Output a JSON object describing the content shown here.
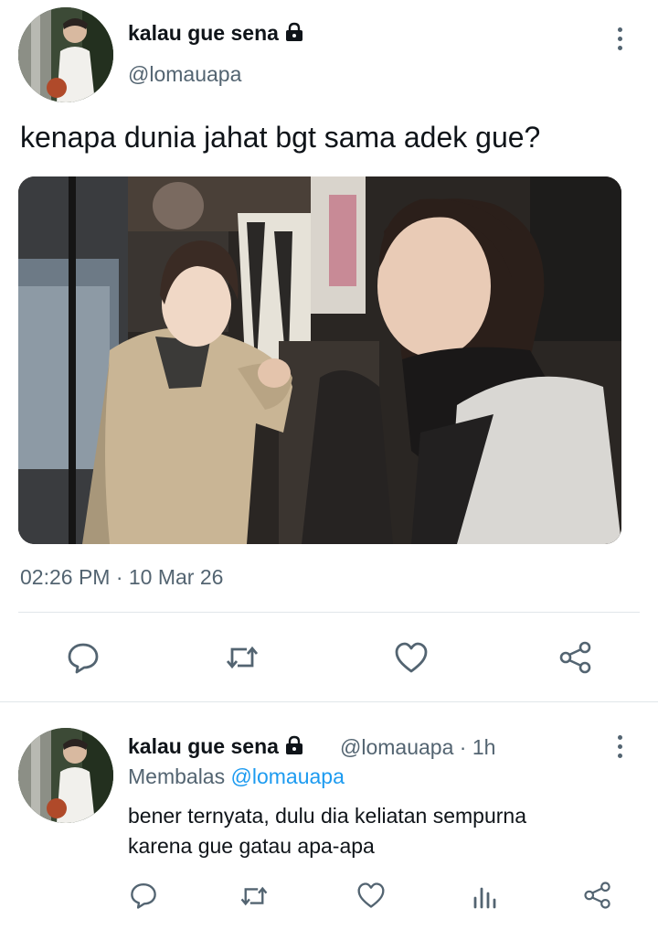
{
  "tweet": {
    "display_name": "kalau gue sena",
    "handle": "@lomauapa",
    "text": "kenapa dunia jahat bgt sama adek gue?",
    "timestamp": "02:26 PM · 10 Mar 26",
    "icons": [
      "lock-icon",
      "more-icon",
      "reply-icon",
      "retweet-icon",
      "like-icon",
      "share-icon"
    ]
  },
  "reply": {
    "display_name": "kalau gue sena",
    "handle": "@lomauapa",
    "separator": " · ",
    "age": "1h",
    "replying_label": "Membalas",
    "replying_to": "@lomauapa",
    "text_line1": "bener ternyata, dulu dia keliatan sempurna",
    "text_line2": "karena gue gatau apa-apa",
    "icons": [
      "reply-icon",
      "retweet-icon",
      "like-icon",
      "analytics-icon",
      "share-icon"
    ]
  },
  "colors": {
    "text_primary": "#0f1419",
    "text_secondary": "#536471",
    "link": "#1d9bf0",
    "divider": "#e1e6ea"
  }
}
